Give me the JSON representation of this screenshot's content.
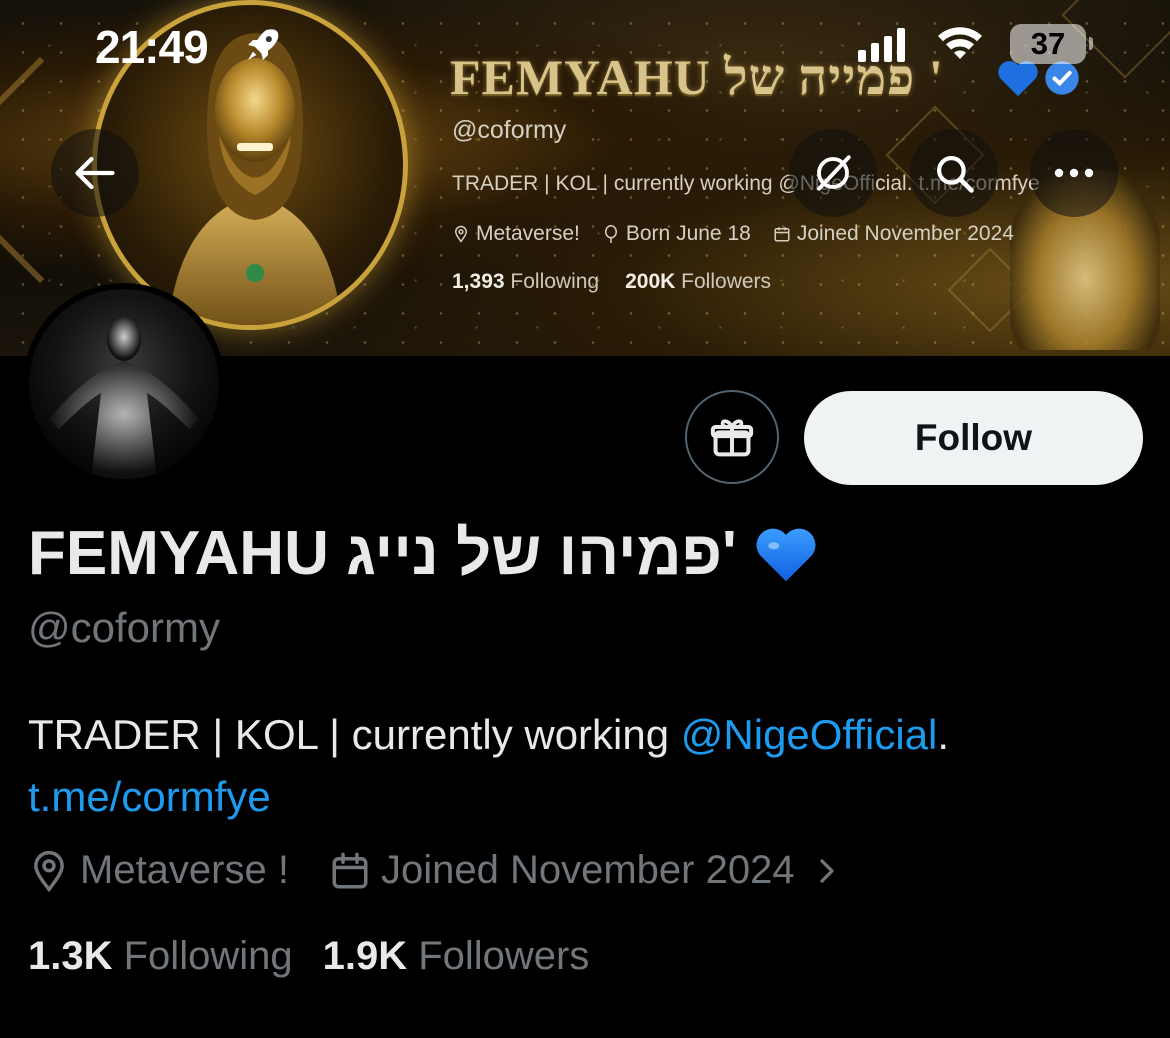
{
  "status_bar": {
    "time": "21:49",
    "battery": "37"
  },
  "banner": {
    "title": "FEMYAHU פמייה של '",
    "handle": "@coformy",
    "bio": "TRADER | KOL | currently working @NigeOfficial. t.me/cormfye",
    "location": "Metaverse!",
    "born": "Born June 18",
    "joined": "Joined November 2024",
    "following_count": "1,393",
    "following_label": "Following",
    "followers_count": "200K",
    "followers_label": "Followers"
  },
  "profile": {
    "display_name": "FEMYAHU פמיהו של נייג'",
    "handle": "@coformy",
    "bio_text": "TRADER | KOL | currently working ",
    "bio_mention": "@NigeOfficial",
    "bio_sep": ". ",
    "bio_link": "t.me/cormfye",
    "location": "Metaverse !",
    "joined": "Joined November 2024",
    "following_count": "1.3K",
    "following_label": "Following",
    "followers_count": "1.9K",
    "followers_label": "Followers"
  },
  "actions": {
    "follow_label": "Follow"
  },
  "icons": {
    "back": "back-arrow-icon",
    "grok": "grok-icon",
    "search": "search-icon",
    "more": "more-icon",
    "gift": "gift-icon",
    "location": "location-pin-icon",
    "calendar": "calendar-icon",
    "heart": "blue-heart-emoji",
    "verified": "verified-badge-icon"
  },
  "colors": {
    "background": "#000000",
    "link": "#1d9bf0",
    "secondary_text": "#71767b",
    "primary_text": "#e7e9ea",
    "follow_button": "#eff3f4",
    "banner_gold": "#c9a23c"
  }
}
